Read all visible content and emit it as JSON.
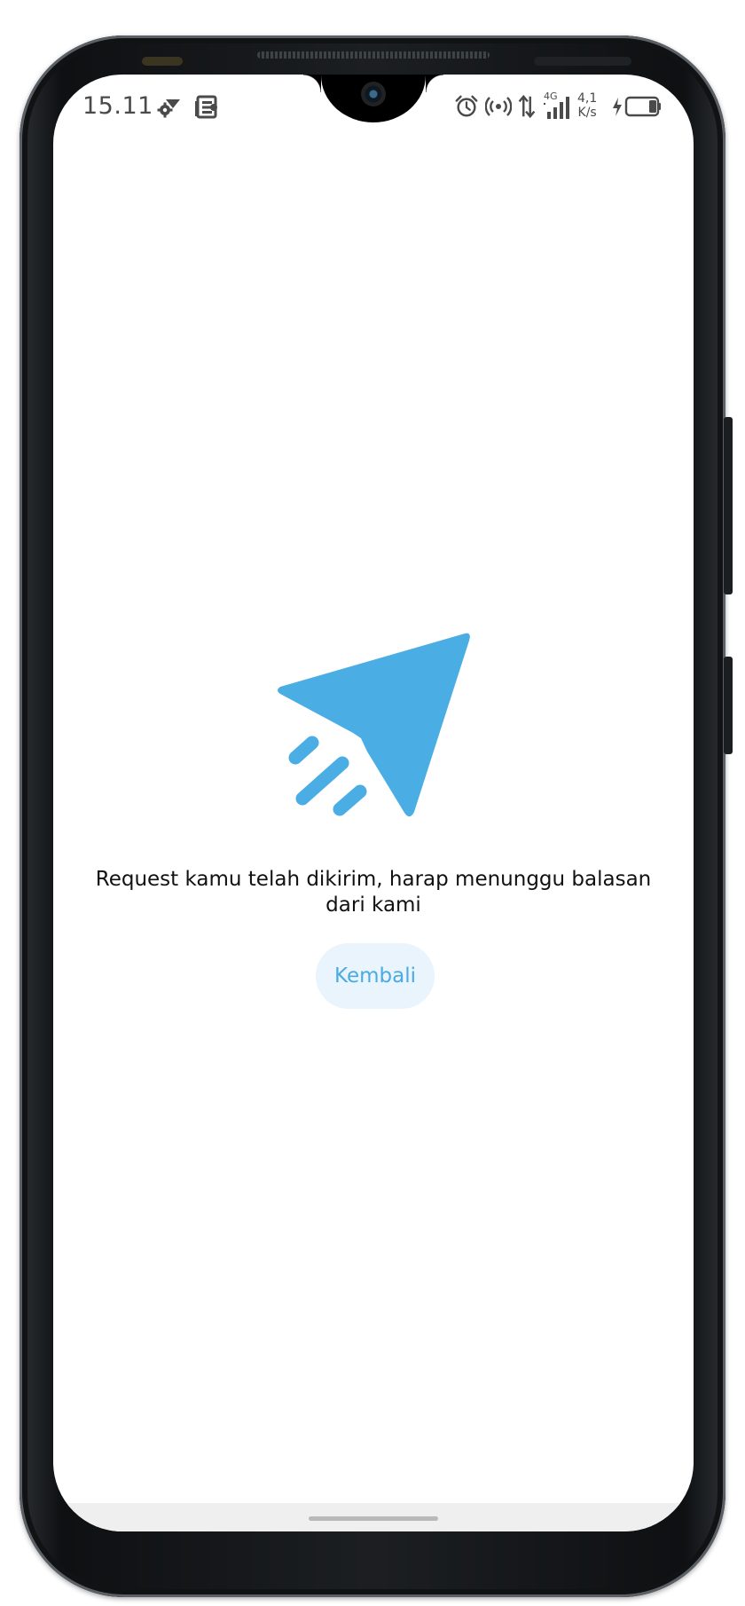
{
  "status_bar": {
    "time": "15.11",
    "network_type": "4G",
    "speed_value": "4,1",
    "speed_unit": "K/s",
    "left_icons": [
      "settings-wifi-icon",
      "news-icon",
      "dot-icon"
    ],
    "right_icons": [
      "alarm-icon",
      "hotspot-icon",
      "data-transfer-icon",
      "signal-icon",
      "charging-icon",
      "battery-icon"
    ]
  },
  "main": {
    "icon": "paper-plane-icon",
    "message": "Request kamu telah dikirim, harap menunggu balasan dari kami",
    "back_button_label": "Kembali"
  },
  "colors": {
    "accent": "#4aabe2",
    "button_background": "#e9f4fc",
    "text": "#111111",
    "status_text": "#4a4a4a"
  }
}
